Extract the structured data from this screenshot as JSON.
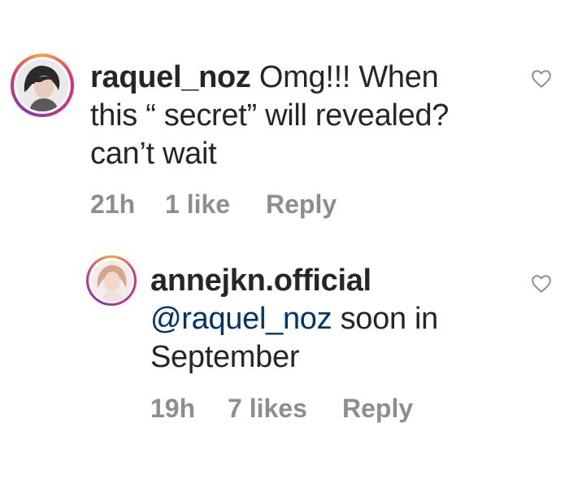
{
  "comments": [
    {
      "username": "raquel_noz",
      "text_line1": "Omg!!! When",
      "text_line2": "this “ secret” will revealed?",
      "text_line3": "can’t wait",
      "time": "21h",
      "likes": "1 like",
      "reply_label": "Reply",
      "like_icon": "heart-outline-icon"
    },
    {
      "username": "annejkn.official",
      "mention": "@raquel_noz",
      "text_line1_rest": " soon in",
      "text_line2": "September",
      "time": "19h",
      "likes": "7 likes",
      "reply_label": "Reply",
      "like_icon": "heart-outline-icon"
    }
  ],
  "colors": {
    "text": "#262626",
    "meta": "#8e8e8e",
    "mention": "#003569"
  }
}
